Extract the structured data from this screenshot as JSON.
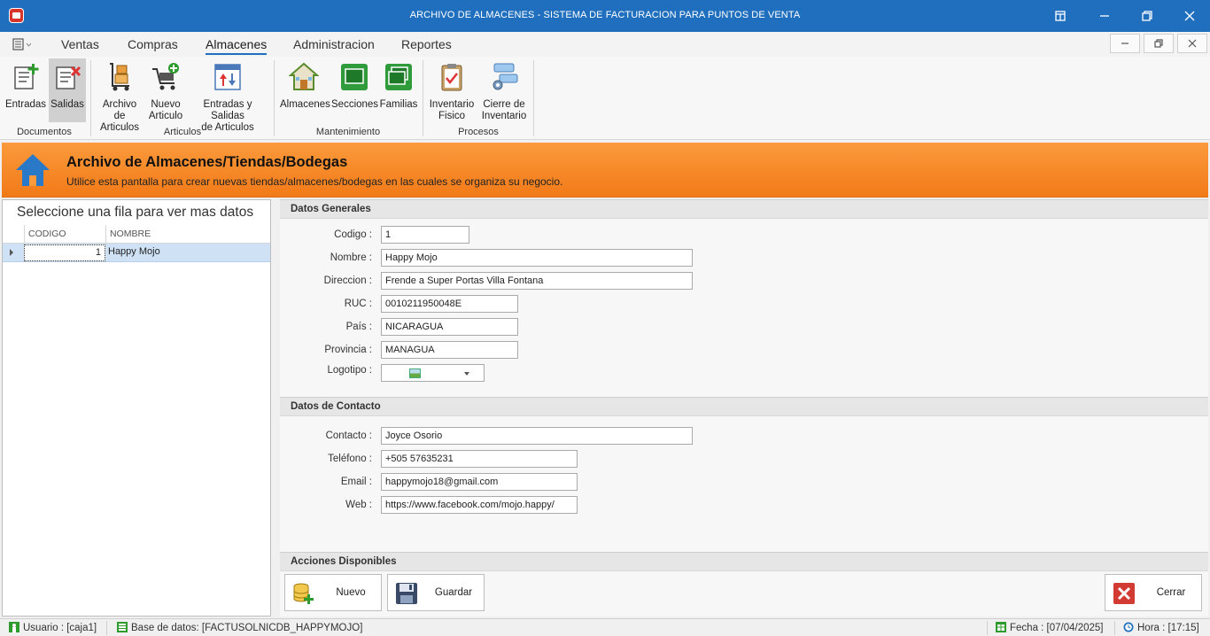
{
  "window": {
    "title": "ARCHIVO DE ALMACENES - SISTEMA DE FACTURACION PARA PUNTOS DE VENTA"
  },
  "ribbon": {
    "tabs": [
      "Ventas",
      "Compras",
      "Almacenes",
      "Administracion",
      "Reportes"
    ],
    "active_tab": "Almacenes",
    "groups": {
      "documentos": "Documentos",
      "articulos": "Articulos",
      "mantenimiento": "Mantenimiento",
      "procesos": "Procesos"
    },
    "buttons": {
      "entradas": "Entradas",
      "salidas": "Salidas",
      "archivo_articulos_1": "Archivo de",
      "archivo_articulos_2": "Articulos",
      "nuevo_articulo_1": "Nuevo",
      "nuevo_articulo_2": "Articulo",
      "entradas_salidas_1": "Entradas y Salidas",
      "entradas_salidas_2": "de Articulos",
      "almacenes": "Almacenes",
      "secciones": "Secciones",
      "familias": "Familias",
      "inventario_fisico_1": "Inventario",
      "inventario_fisico_2": "Fisico",
      "cierre_inventario_1": "Cierre de",
      "cierre_inventario_2": "Inventario"
    }
  },
  "banner": {
    "title": "Archivo de Almacenes/Tiendas/Bodegas",
    "subtitle": "Utilice esta pantalla para crear nuevas tiendas/almacenes/bodegas en las cuales se organiza su negocio."
  },
  "grid": {
    "title": "Seleccione una fila para ver mas datos",
    "columns": [
      "CODIGO",
      "NOMBRE"
    ],
    "rows": [
      {
        "codigo": "1",
        "nombre": "Happy Mojo"
      }
    ]
  },
  "datos_generales": {
    "heading": "Datos Generales",
    "codigo_label": "Codigo :",
    "codigo": "1",
    "nombre_label": "Nombre :",
    "nombre": "Happy Mojo",
    "direccion_label": "Direccion :",
    "direccion": "Frende a Super Portas Villa Fontana",
    "ruc_label": "RUC :",
    "ruc": "0010211950048E",
    "pais_label": "País :",
    "pais": "NICARAGUA",
    "provincia_label": "Provincia :",
    "provincia": "MANAGUA",
    "logotipo_label": "Logotipo :"
  },
  "datos_contacto": {
    "heading": "Datos de Contacto",
    "contacto_label": "Contacto :",
    "contacto": "Joyce Osorio",
    "telefono_label": "Teléfono :",
    "telefono": "+505 57635231",
    "email_label": "Email :",
    "email": "happymojo18@gmail.com",
    "web_label": "Web :",
    "web": "https://www.facebook.com/mojo.happy/"
  },
  "acciones": {
    "heading": "Acciones Disponibles",
    "nuevo": "Nuevo",
    "guardar": "Guardar",
    "cerrar": "Cerrar"
  },
  "status": {
    "usuario": "Usuario : [caja1]",
    "base_datos": "Base de datos: [FACTUSOLNICDB_HAPPYMOJO]",
    "fecha": "Fecha : [07/04/2025]",
    "hora": "Hora : [17:15]"
  },
  "colors": {
    "titlebar": "#1f6fbe",
    "banner": "#f7891f",
    "selection": "#cfe2f5"
  }
}
